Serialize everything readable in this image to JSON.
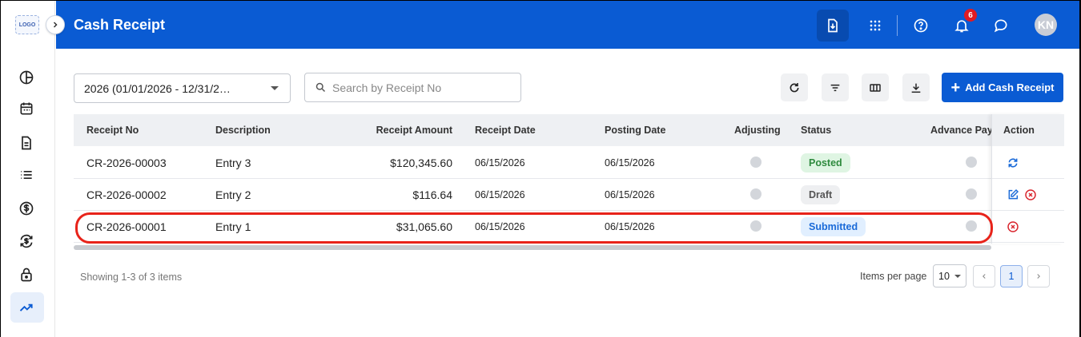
{
  "sidebar": {
    "logo_text": "LOGO",
    "icons": [
      "pie-chart-icon",
      "calendar-icon",
      "document-icon",
      "list-icon",
      "dollar-icon",
      "exchange-dollar-icon",
      "lock-icon",
      "trending-up-icon"
    ],
    "active_index": 7
  },
  "header": {
    "title": "Cash Receipt",
    "notification_count": "6",
    "avatar_initials": "KN",
    "brand_color": "#0a5bd3"
  },
  "toolbar": {
    "year_selected": "2026 (01/01/2026 - 12/31/2…",
    "search_placeholder": "Search by Receipt No",
    "add_button_label": "Add Cash Receipt"
  },
  "table": {
    "columns": [
      "Receipt No",
      "Description",
      "Receipt Amount",
      "Receipt Date",
      "Posting Date",
      "Adjusting",
      "Status",
      "Advance Payı",
      "Action"
    ],
    "rows": [
      {
        "receipt_no": "CR-2026-00003",
        "description": "Entry 3",
        "amount": "$120,345.60",
        "receipt_date": "06/15/2026",
        "posting_date": "06/15/2026",
        "status": "Posted",
        "actions": [
          "sync"
        ]
      },
      {
        "receipt_no": "CR-2026-00002",
        "description": "Entry 2",
        "amount": "$116.64",
        "receipt_date": "06/15/2026",
        "posting_date": "06/15/2026",
        "status": "Draft",
        "actions": [
          "edit",
          "cancel"
        ]
      },
      {
        "receipt_no": "CR-2026-00001",
        "description": "Entry 1",
        "amount": "$31,065.60",
        "receipt_date": "06/15/2026",
        "posting_date": "06/15/2026",
        "status": "Submitted",
        "actions": [
          "cancel"
        ]
      }
    ],
    "status_colors": {
      "Posted": {
        "bg": "#dff5e3",
        "fg": "#2e8a3e"
      },
      "Draft": {
        "bg": "#eeeff1",
        "fg": "#555555"
      },
      "Submitted": {
        "bg": "#e1efff",
        "fg": "#1a6ad8"
      }
    },
    "highlight_color": "#e8231a"
  },
  "footer": {
    "showing_text": "Showing 1-3 of 3 items",
    "items_per_page_label": "Items per page",
    "items_per_page_value": "10",
    "current_page": "1"
  }
}
